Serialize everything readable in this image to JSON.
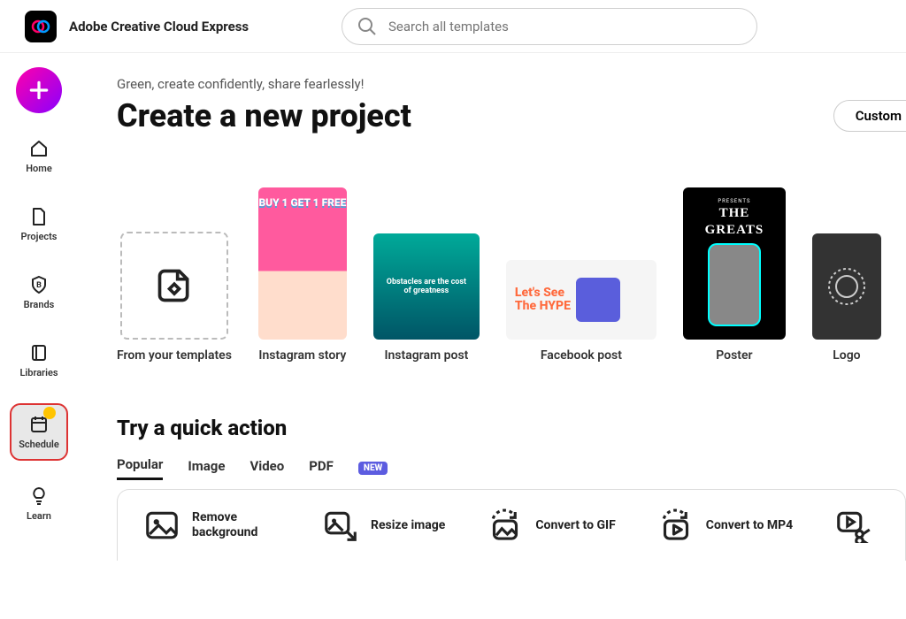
{
  "header": {
    "app_title": "Adobe Creative Cloud Express",
    "search_placeholder": "Search all templates"
  },
  "sidebar": {
    "items": [
      {
        "label": "Home"
      },
      {
        "label": "Projects"
      },
      {
        "label": "Brands"
      },
      {
        "label": "Libraries"
      },
      {
        "label": "Schedule"
      },
      {
        "label": "Learn"
      }
    ]
  },
  "main": {
    "tagline": "Green, create confidently, share fearlessly!",
    "title": "Create a new project",
    "custom_button": "Custom",
    "templates": [
      {
        "label": "From your templates"
      },
      {
        "label": "Instagram story",
        "promo": "BUY 1 GET 1 FREE"
      },
      {
        "label": "Instagram post",
        "promo": "Obstacles are the cost of greatness"
      },
      {
        "label": "Facebook post",
        "promo_l1": "Let's See",
        "promo_l2": "The HYPE"
      },
      {
        "label": "Poster",
        "sub": "PRESENTS",
        "big1": "THE",
        "big2": "GREATS"
      },
      {
        "label": "Logo"
      }
    ]
  },
  "quick": {
    "title": "Try a quick action",
    "tabs": [
      {
        "label": "Popular"
      },
      {
        "label": "Image"
      },
      {
        "label": "Video"
      },
      {
        "label": "PDF"
      }
    ],
    "new_badge": "NEW",
    "actions": [
      {
        "label": "Remove background"
      },
      {
        "label": "Resize image"
      },
      {
        "label": "Convert to GIF"
      },
      {
        "label": "Convert to MP4"
      }
    ]
  }
}
